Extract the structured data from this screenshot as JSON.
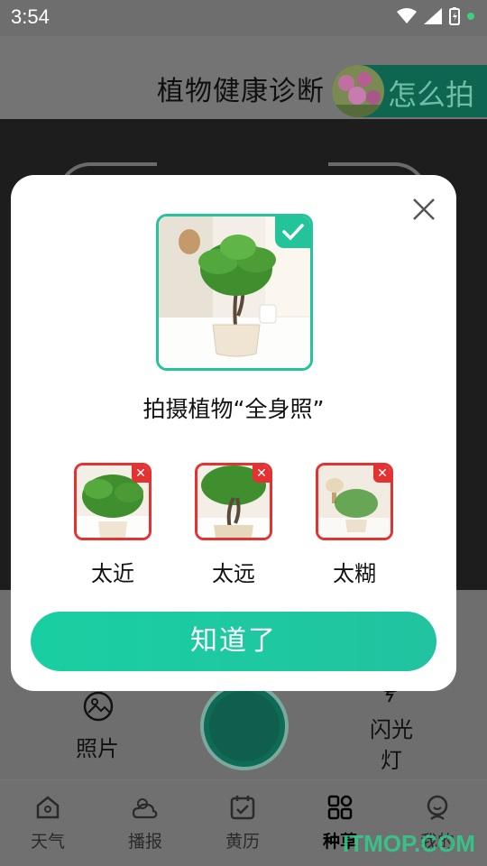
{
  "status_bar": {
    "time": "3:54"
  },
  "header": {
    "title": "植物健康诊断",
    "howto_label": "怎么拍"
  },
  "camera": {
    "photo_label": "照片",
    "flash_label": "闪光灯"
  },
  "tabs": [
    {
      "label": "天气",
      "icon": "home-icon"
    },
    {
      "label": "播报",
      "icon": "weather-icon"
    },
    {
      "label": "黄历",
      "icon": "calendar-icon"
    },
    {
      "label": "种草",
      "icon": "grid-icon",
      "active": true
    },
    {
      "label": "我的",
      "icon": "profile-icon"
    }
  ],
  "modal": {
    "title": "拍摄植物“全身照”",
    "examples": [
      {
        "label": "太近"
      },
      {
        "label": "太远"
      },
      {
        "label": "太糊"
      }
    ],
    "confirm_label": "知道了"
  },
  "watermark": "ITMOP.COM",
  "colors": {
    "accent": "#23c49a",
    "error": "#e23232",
    "dark_green": "#0e6650"
  }
}
